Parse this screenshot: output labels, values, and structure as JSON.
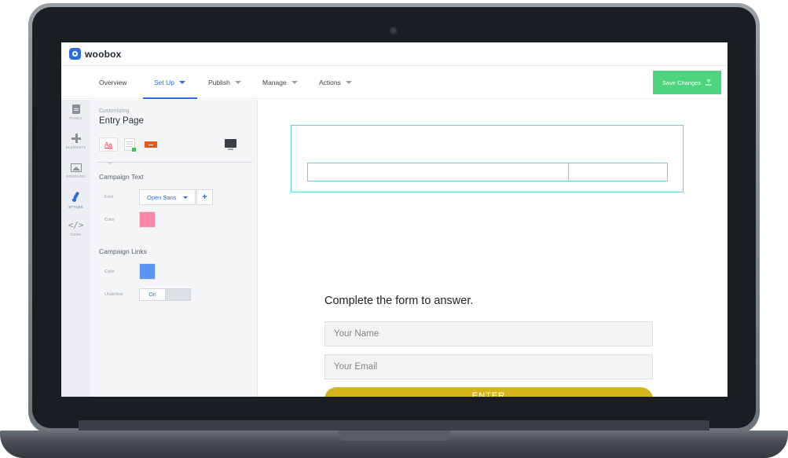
{
  "app": {
    "name": "woobox",
    "brand_color": "#2d6cdf"
  },
  "nav": {
    "tabs": [
      {
        "label": "Overview",
        "has_dropdown": false,
        "active": false
      },
      {
        "label": "Set Up",
        "has_dropdown": true,
        "active": true
      },
      {
        "label": "Publish",
        "has_dropdown": true,
        "active": false
      },
      {
        "label": "Manage",
        "has_dropdown": true,
        "active": false
      },
      {
        "label": "Actions",
        "has_dropdown": true,
        "active": false
      }
    ],
    "save_label": "Save Changes",
    "save_color": "#4cd47f"
  },
  "rail": {
    "items": [
      {
        "label": "PAGES",
        "icon": "page-icon",
        "active": false
      },
      {
        "label": "ELEMENTS",
        "icon": "plus-icon",
        "active": false
      },
      {
        "label": "BGROUND",
        "icon": "image-icon",
        "active": false
      },
      {
        "label": "STYLES",
        "icon": "brush-icon",
        "active": true
      },
      {
        "label": "CODE",
        "icon": "code-icon",
        "active": false
      }
    ]
  },
  "panel": {
    "subtitle": "Customizing",
    "title": "Entry Page",
    "text_tool_label": "Aa",
    "campaign_text": {
      "heading": "Campaign Text",
      "font_label": "Font",
      "font_value": "Open Sans",
      "add_label": "+",
      "color_label": "Color",
      "color_value": "#ff87a8"
    },
    "campaign_links": {
      "heading": "Campaign Links",
      "color_label": "Color",
      "color_value": "#5c95f7",
      "underline_label": "Underline",
      "underline_value": "On"
    }
  },
  "preview": {
    "form_heading": "Complete the form to answer.",
    "name_placeholder": "Your Name",
    "email_placeholder": "Your Email",
    "submit_label": "ENTER",
    "submit_color": "#d4b51c"
  }
}
